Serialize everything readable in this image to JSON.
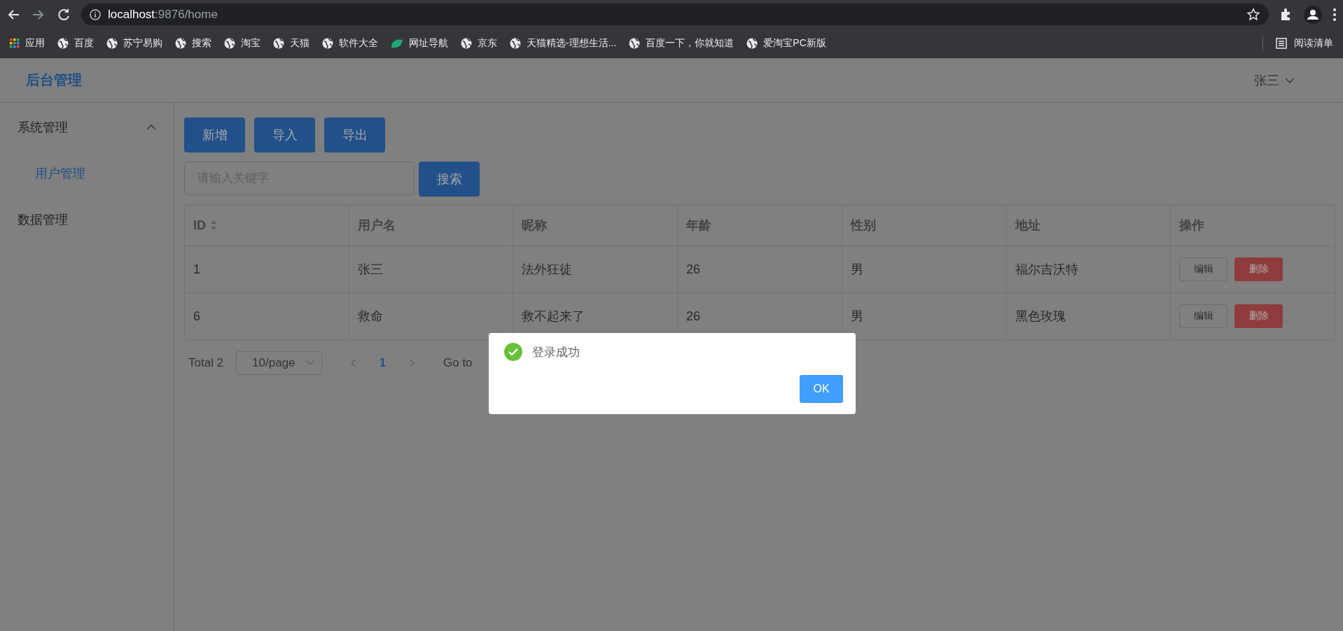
{
  "browser": {
    "address": {
      "host": "localhost",
      "path": ":9876/home"
    },
    "bookmarks": [
      {
        "kind": "apps",
        "label": "应用"
      },
      {
        "kind": "globe",
        "label": "百度"
      },
      {
        "kind": "globe",
        "label": "苏宁易购"
      },
      {
        "kind": "globe",
        "label": "搜索"
      },
      {
        "kind": "globe",
        "label": "淘宝"
      },
      {
        "kind": "globe",
        "label": "天猫"
      },
      {
        "kind": "globe",
        "label": "软件大全"
      },
      {
        "kind": "leaf",
        "label": "网址导航"
      },
      {
        "kind": "globe",
        "label": "京东"
      },
      {
        "kind": "globe",
        "label": "天猫精选-理想生活..."
      },
      {
        "kind": "globe",
        "label": "百度一下，你就知道"
      },
      {
        "kind": "globe",
        "label": "爱淘宝PC新版"
      }
    ],
    "reading_list": "阅读清单"
  },
  "app": {
    "brand": "后台管理",
    "user": "张三",
    "sidebar": [
      {
        "label": "系统管理",
        "expanded": true,
        "children": [
          {
            "label": "用户管理",
            "selected": true
          }
        ]
      },
      {
        "label": "数据管理",
        "selected": false
      }
    ],
    "toolbar": [
      "新增",
      "导入",
      "导出"
    ],
    "search": {
      "placeholder": "请输入关键字",
      "button": "搜索"
    },
    "table": {
      "columns": [
        {
          "label": "ID",
          "sortable": true
        },
        {
          "label": "用户名",
          "sortable": false
        },
        {
          "label": "昵称",
          "sortable": false
        },
        {
          "label": "年龄",
          "sortable": false
        },
        {
          "label": "性别",
          "sortable": false
        },
        {
          "label": "地址",
          "sortable": false
        },
        {
          "label": "操作",
          "sortable": false
        }
      ],
      "rows": [
        {
          "cells": [
            "1",
            "张三",
            "法外狂徒",
            "26",
            "男",
            "福尔吉沃特"
          ],
          "actions": [
            {
              "kind": "plain",
              "label": "编辑"
            },
            {
              "kind": "danger",
              "label": "删除"
            }
          ]
        },
        {
          "cells": [
            "6",
            "救命",
            "救不起来了",
            "26",
            "男",
            "黑色玫瑰"
          ],
          "actions": [
            {
              "kind": "plain",
              "label": "编辑"
            },
            {
              "kind": "danger",
              "label": "删除"
            }
          ]
        }
      ]
    },
    "pagination": {
      "total": "Total 2",
      "page_size": "10/page",
      "pages": [
        {
          "label": "1",
          "selected": true
        }
      ],
      "goto": "Go to"
    }
  },
  "dialog": {
    "kind": "success",
    "message": "登录成功",
    "button": "OK"
  }
}
